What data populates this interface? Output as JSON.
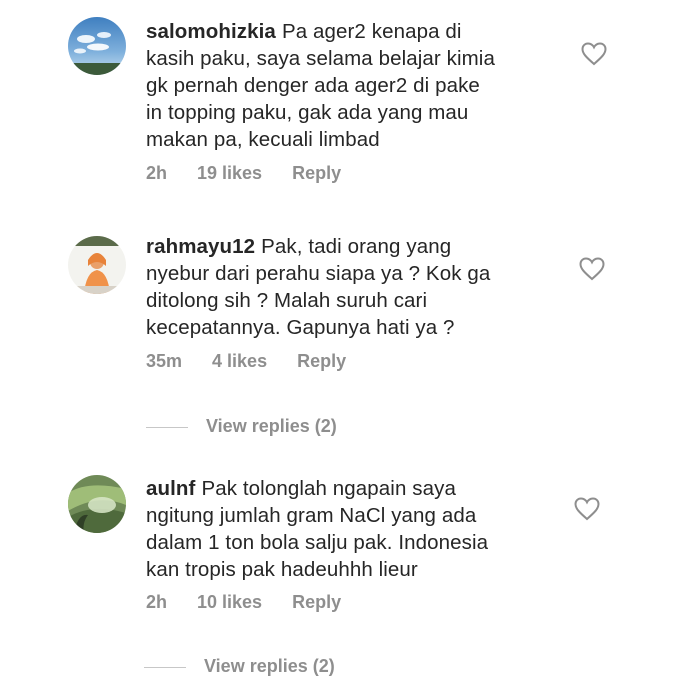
{
  "comments": [
    {
      "username": "salomohizkia",
      "lines": [
        "Pa ager2 kenapa di",
        "kasih paku, saya selama belajar kimia",
        "gk pernah denger ada ager2 di pake",
        "in topping paku, gak ada yang mau",
        "makan pa, kecuali limbad"
      ],
      "time": "2h",
      "likes": "19 likes",
      "reply": "Reply",
      "avatar_icon": "sky-avatar-icon"
    },
    {
      "username": "rahmayu12",
      "lines": [
        "Pak, tadi orang yang",
        "nyebur dari perahu siapa ya ? Kok ga",
        "ditolong sih ? Malah suruh cari",
        "kecepatannya. Gapunya hati ya ?"
      ],
      "time": "35m",
      "likes": "4 likes",
      "reply": "Reply",
      "view_replies": "View replies (2)",
      "avatar_icon": "girl-avatar-icon"
    },
    {
      "username": "aulnf",
      "lines": [
        "Pak tolonglah ngapain saya",
        "ngitung jumlah gram NaCl yang ada",
        "dalam 1 ton bola salju pak. Indonesia",
        "kan tropis pak hadeuhhh lieur"
      ],
      "time": "2h",
      "likes": "10 likes",
      "reply": "Reply",
      "view_replies": "View replies (2)",
      "avatar_icon": "leaf-avatar-icon"
    }
  ],
  "colors": {
    "text": "#262626",
    "muted": "#8e8e8e",
    "heart": "#8e8e8e"
  }
}
